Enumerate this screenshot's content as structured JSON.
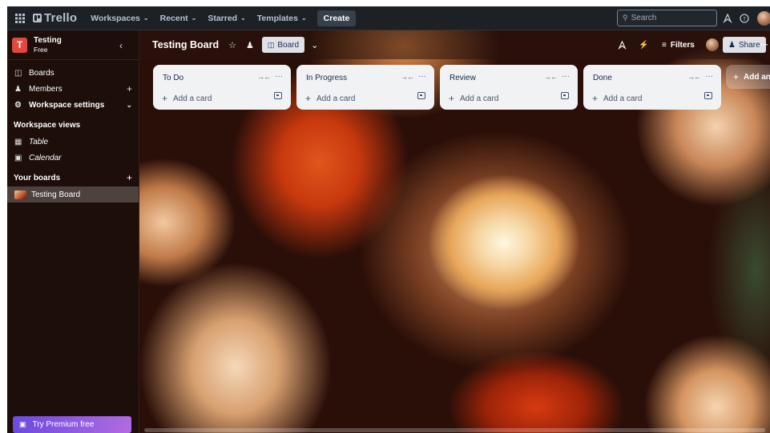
{
  "topbar": {
    "logo": "Trello",
    "menus": [
      {
        "label": "Workspaces"
      },
      {
        "label": "Recent"
      },
      {
        "label": "Starred"
      },
      {
        "label": "Templates"
      }
    ],
    "create_label": "Create",
    "search_placeholder": "Search"
  },
  "sidebar": {
    "workspace_initial": "T",
    "workspace_name": "Testing",
    "workspace_plan": "Free",
    "items": [
      {
        "label": "Boards"
      },
      {
        "label": "Members"
      },
      {
        "label": "Workspace settings"
      }
    ],
    "views_heading": "Workspace views",
    "views": [
      {
        "label": "Table"
      },
      {
        "label": "Calendar"
      }
    ],
    "your_boards_heading": "Your boards",
    "boards": [
      {
        "label": "Testing Board"
      }
    ],
    "premium_label": "Try Premium free"
  },
  "board": {
    "title": "Testing Board",
    "view_label": "Board",
    "filters_label": "Filters",
    "share_label": "Share",
    "lists": [
      {
        "title": "To Do",
        "add_card": "Add a card"
      },
      {
        "title": "In Progress",
        "add_card": "Add a card"
      },
      {
        "title": "Review",
        "add_card": "Add a card"
      },
      {
        "title": "Done",
        "add_card": "Add a card"
      }
    ],
    "add_list_label": "Add anoth"
  },
  "colors": {
    "topbar_bg": "#1d2125",
    "workspace_avatar": "#e2483d",
    "list_bg": "#f1f2f4",
    "premium_gradient_start": "#6c4ae0",
    "premium_gradient_end": "#b06be0"
  }
}
